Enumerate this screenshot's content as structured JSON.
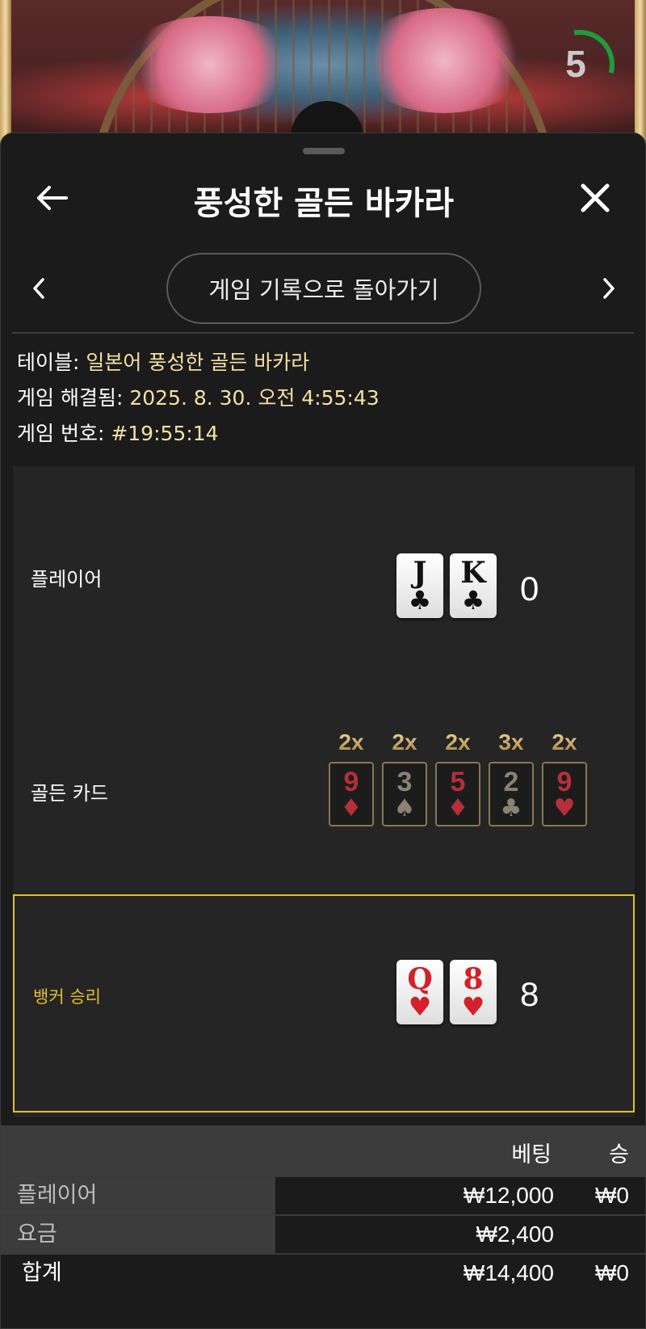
{
  "timer": {
    "value": "5"
  },
  "header": {
    "title": "풍성한 골든 바카라"
  },
  "nav": {
    "history_label": "게임 기록으로 돌아가기"
  },
  "info": {
    "table_key": "테이블: ",
    "table_value": "일본어 풍성한 골든 바카라",
    "resolved_key": "게임 해결됨: ",
    "resolved_value": "2025. 8. 30. 오전 4:55:43",
    "number_key": "게임 번호: ",
    "number_value": "#19:55:14"
  },
  "player": {
    "label": "플레이어",
    "cards": [
      {
        "rank": "J",
        "suit": "♣",
        "color": "black"
      },
      {
        "rank": "K",
        "suit": "♣",
        "color": "black"
      }
    ],
    "score": "0"
  },
  "golden": {
    "label": "골든 카드",
    "cards": [
      {
        "mult": "2x",
        "rank": "9",
        "suit": "♦",
        "color": "red"
      },
      {
        "mult": "2x",
        "rank": "3",
        "suit": "♠",
        "color": "dark"
      },
      {
        "mult": "2x",
        "rank": "5",
        "suit": "♦",
        "color": "red"
      },
      {
        "mult": "3x",
        "rank": "2",
        "suit": "♣",
        "color": "dark"
      },
      {
        "mult": "2x",
        "rank": "9",
        "suit": "♥",
        "color": "red"
      }
    ]
  },
  "banker": {
    "label": "뱅커 승리",
    "cards": [
      {
        "rank": "Q",
        "suit": "♥",
        "color": "red"
      },
      {
        "rank": "8",
        "suit": "♥",
        "color": "red"
      }
    ],
    "score": "8"
  },
  "bets": {
    "col_bet": "베팅",
    "col_win": "승",
    "rows": [
      {
        "label": "플레이어",
        "bet": "₩12,000",
        "win": "₩0"
      },
      {
        "label": "요금",
        "bet": "₩2,400",
        "win": ""
      }
    ],
    "total": {
      "label": "합계",
      "bet": "₩14,400",
      "win": "₩0"
    }
  },
  "colors": {
    "accent_gold": "#e2c02a",
    "info_value": "#f3e0a6",
    "timer_ring": "#1f9c3a"
  }
}
